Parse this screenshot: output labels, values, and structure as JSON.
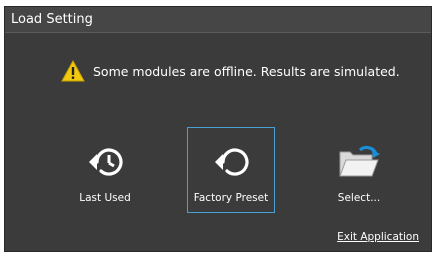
{
  "dialog": {
    "title": "Load Setting",
    "warning": {
      "icon": "warning-icon",
      "text": "Some modules are offline. Results are simulated."
    },
    "options": [
      {
        "label": "Last Used",
        "icon": "history-icon"
      },
      {
        "label": "Factory Preset",
        "icon": "reset-icon",
        "selected": true
      },
      {
        "label": "Select...",
        "icon": "folder-open-icon"
      }
    ],
    "exit_link": "Exit Application"
  },
  "colors": {
    "background": "#3b3b3b",
    "titlebar": "#464646",
    "selection_border": "#4a9fd4",
    "warning_yellow": "#f2c811",
    "folder_blue": "#1a8fd6"
  }
}
